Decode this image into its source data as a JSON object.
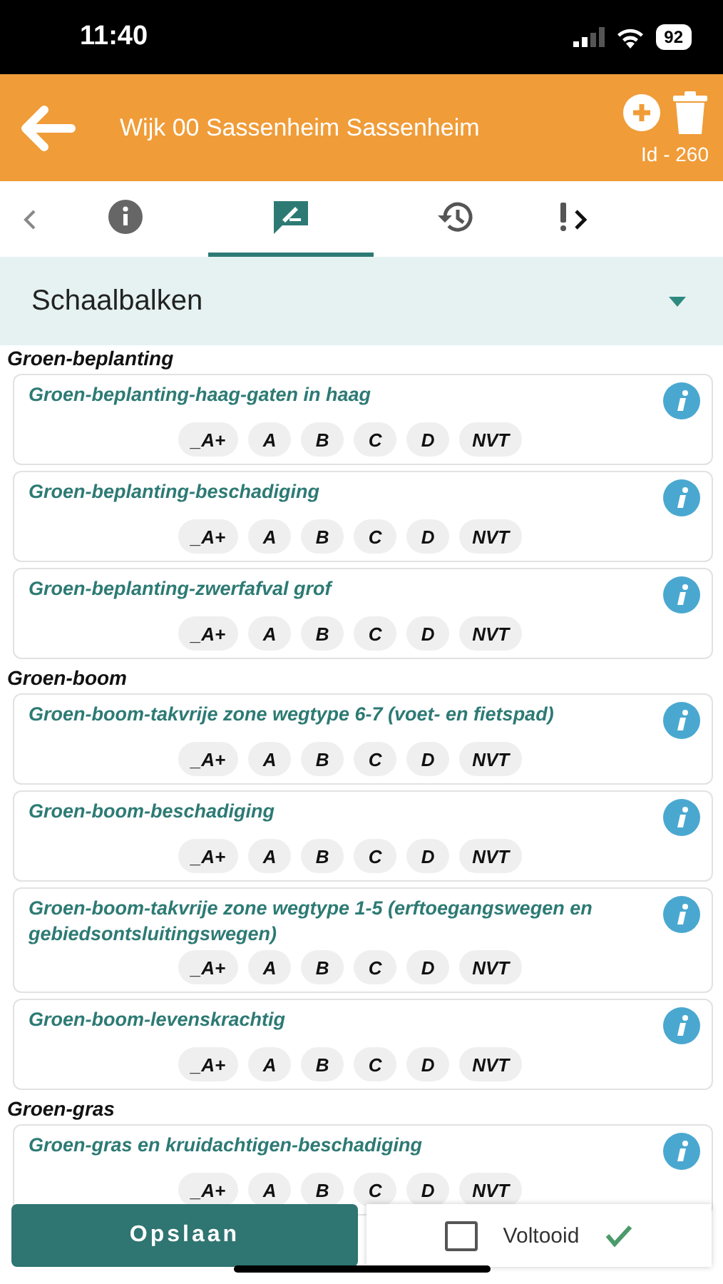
{
  "status_bar": {
    "time": "11:40",
    "battery": "92"
  },
  "header": {
    "title": "Wijk 00 Sassenheim Sassenheim",
    "id_label": "Id - 260"
  },
  "tabs": [
    {
      "kind": "info",
      "selected": false
    },
    {
      "kind": "comment",
      "selected": true
    },
    {
      "kind": "history",
      "selected": false
    },
    {
      "kind": "alert",
      "selected": false
    }
  ],
  "section": {
    "title": "Schaalbalken",
    "expanded": true
  },
  "groups": [
    {
      "title": "Groen-beplanting",
      "items": [
        {
          "title": "Groen-beplanting-haag-gaten in haag",
          "options": [
            {
              "label": "_A+",
              "selected": false
            },
            {
              "label": "A",
              "selected": false
            },
            {
              "label": "B",
              "selected": false
            },
            {
              "label": "C",
              "selected": false
            },
            {
              "label": "D",
              "selected": false
            },
            {
              "label": "NVT",
              "selected": false
            }
          ]
        },
        {
          "title": "Groen-beplanting-beschadiging",
          "options": [
            {
              "label": "_A+",
              "selected": false
            },
            {
              "label": "A",
              "selected": false
            },
            {
              "label": "B",
              "selected": false
            },
            {
              "label": "C",
              "selected": false
            },
            {
              "label": "D",
              "selected": false
            },
            {
              "label": "NVT",
              "selected": false
            }
          ]
        },
        {
          "title": "Groen-beplanting-zwerfafval grof",
          "options": [
            {
              "label": "_A+",
              "selected": false
            },
            {
              "label": "A",
              "selected": false
            },
            {
              "label": "B",
              "selected": false
            },
            {
              "label": "C",
              "selected": false
            },
            {
              "label": "D",
              "selected": false
            },
            {
              "label": "NVT",
              "selected": false
            }
          ]
        }
      ]
    },
    {
      "title": "Groen-boom",
      "items": [
        {
          "title": "Groen-boom-takvrije zone wegtype 6-7 (voet- en fietspad)",
          "options": [
            {
              "label": "_A+",
              "selected": false
            },
            {
              "label": "A",
              "selected": false
            },
            {
              "label": "B",
              "selected": false
            },
            {
              "label": "C",
              "selected": false
            },
            {
              "label": "D",
              "selected": false
            },
            {
              "label": "NVT",
              "selected": false
            }
          ]
        },
        {
          "title": "Groen-boom-beschadiging",
          "options": [
            {
              "label": "_A+",
              "selected": false
            },
            {
              "label": "A",
              "selected": false
            },
            {
              "label": "B",
              "selected": false
            },
            {
              "label": "C",
              "selected": false
            },
            {
              "label": "D",
              "selected": false
            },
            {
              "label": "NVT",
              "selected": false
            }
          ]
        },
        {
          "title": "Groen-boom-takvrije zone wegtype 1-5 (erftoegangswegen en gebiedsontsluitingswegen)",
          "options": [
            {
              "label": "_A+",
              "selected": false
            },
            {
              "label": "A",
              "selected": false
            },
            {
              "label": "B",
              "selected": false
            },
            {
              "label": "C",
              "selected": false
            },
            {
              "label": "D",
              "selected": false
            },
            {
              "label": "NVT",
              "selected": false
            }
          ]
        },
        {
          "title": "Groen-boom-levenskrachtig",
          "options": [
            {
              "label": "_A+",
              "selected": false
            },
            {
              "label": "A",
              "selected": false
            },
            {
              "label": "B",
              "selected": false
            },
            {
              "label": "C",
              "selected": false
            },
            {
              "label": "D",
              "selected": false
            },
            {
              "label": "NVT",
              "selected": false
            }
          ]
        }
      ]
    },
    {
      "title": "Groen-gras",
      "items": [
        {
          "title": "Groen-gras en kruidachtigen-beschadiging",
          "options": [
            {
              "label": "_A+",
              "selected": false
            },
            {
              "label": "A",
              "selected": false
            },
            {
              "label": "B",
              "selected": false
            },
            {
              "label": "C",
              "selected": false
            },
            {
              "label": "D",
              "selected": false
            },
            {
              "label": "NVT",
              "selected": false
            }
          ]
        }
      ]
    }
  ],
  "footer": {
    "save_label": "Opslaan",
    "done_label": "Voltooid",
    "done_checked": false
  }
}
